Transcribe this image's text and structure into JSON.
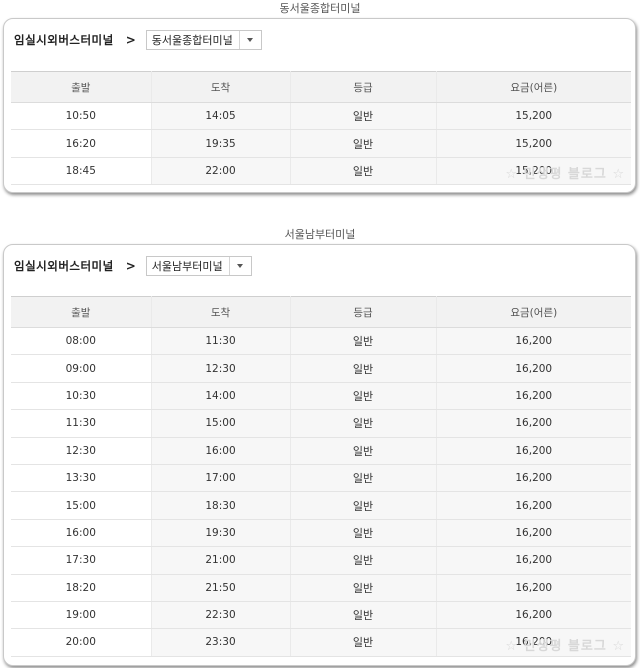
{
  "sections": [
    {
      "title": "동서울종합터미널",
      "origin": "임실시외버스터미널",
      "arrow": ">",
      "destination": "동서울종합터미널",
      "headers": [
        "출발",
        "도착",
        "등급",
        "요금(어른)"
      ],
      "rows": [
        [
          "10:50",
          "14:05",
          "일반",
          "15,200"
        ],
        [
          "16:20",
          "19:35",
          "일반",
          "15,200"
        ],
        [
          "18:45",
          "22:00",
          "일반",
          "15,200"
        ]
      ],
      "watermark": "☆ 민생평 블로그 ☆"
    },
    {
      "title": "서울남부터미널",
      "origin": "임실시외버스터미널",
      "arrow": ">",
      "destination": "서울남부터미널",
      "headers": [
        "출발",
        "도착",
        "등급",
        "요금(어른)"
      ],
      "rows": [
        [
          "08:00",
          "11:30",
          "일반",
          "16,200"
        ],
        [
          "09:00",
          "12:30",
          "일반",
          "16,200"
        ],
        [
          "10:30",
          "14:00",
          "일반",
          "16,200"
        ],
        [
          "11:30",
          "15:00",
          "일반",
          "16,200"
        ],
        [
          "12:30",
          "16:00",
          "일반",
          "16,200"
        ],
        [
          "13:30",
          "17:00",
          "일반",
          "16,200"
        ],
        [
          "15:00",
          "18:30",
          "일반",
          "16,200"
        ],
        [
          "16:00",
          "19:30",
          "일반",
          "16,200"
        ],
        [
          "17:30",
          "21:00",
          "일반",
          "16,200"
        ],
        [
          "18:20",
          "21:50",
          "일반",
          "16,200"
        ],
        [
          "19:00",
          "22:30",
          "일반",
          "16,200"
        ],
        [
          "20:00",
          "23:30",
          "일반",
          "16,200"
        ]
      ],
      "watermark": "☆ 민생평 블로그 ☆"
    }
  ]
}
